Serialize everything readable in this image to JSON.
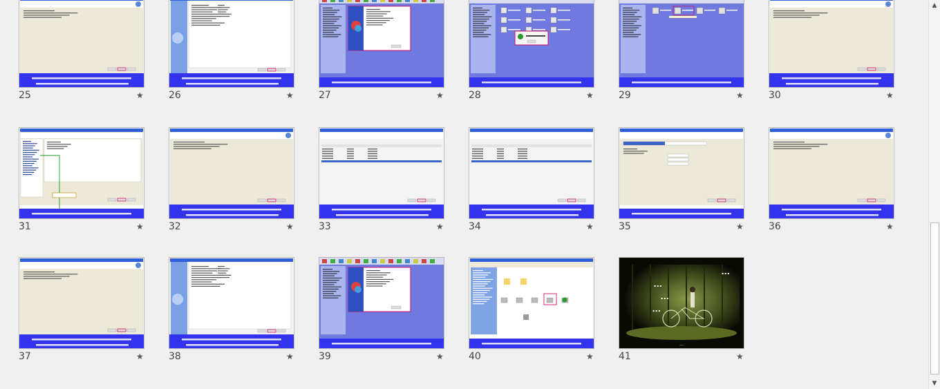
{
  "slides": [
    {
      "number": "25",
      "template": "wizard"
    },
    {
      "number": "26",
      "template": "list"
    },
    {
      "number": "27",
      "template": "acronis"
    },
    {
      "number": "28",
      "template": "dialog"
    },
    {
      "number": "29",
      "template": "icons"
    },
    {
      "number": "30",
      "template": "wizard"
    },
    {
      "number": "31",
      "template": "tree"
    },
    {
      "number": "32",
      "template": "wizard"
    },
    {
      "number": "33",
      "template": "table"
    },
    {
      "number": "34",
      "template": "table"
    },
    {
      "number": "35",
      "template": "progress"
    },
    {
      "number": "36",
      "template": "wizard"
    },
    {
      "number": "37",
      "template": "wizard"
    },
    {
      "number": "38",
      "template": "list"
    },
    {
      "number": "39",
      "template": "acronis"
    },
    {
      "number": "40",
      "template": "explorer"
    },
    {
      "number": "41",
      "template": "photo"
    }
  ],
  "slide41": {
    "overlay_lines": [
      "...",
      "...",
      "...",
      "..."
    ],
    "footer_text": "..."
  },
  "star_glyph": "★",
  "scrollbar": {
    "up_glyph": "▲",
    "down_glyph": "▼"
  },
  "colors": {
    "caption_bar": "#3333ee",
    "caption_text": "#ffffff",
    "title_bar": "#2f5fd8",
    "wizard_body": "#ece9d8",
    "desktop_blue": "#6f79e0",
    "highlight": "#cc1166",
    "photo_dark": "#0a0a05"
  }
}
